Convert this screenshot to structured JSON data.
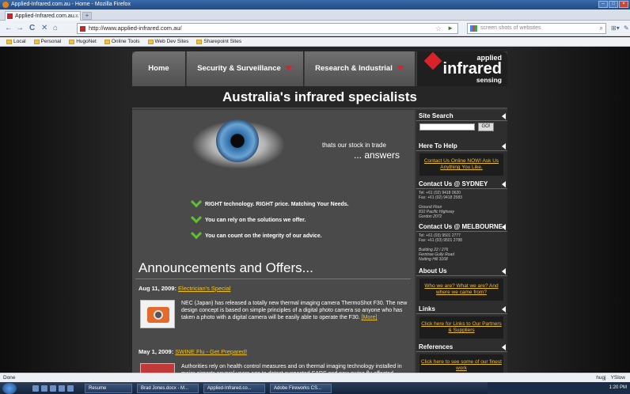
{
  "window": {
    "title": "Applied-Infrared.com.au - Home - Mozilla Firefox"
  },
  "tab": {
    "label": "Applied-Infrared.com.au...",
    "close": "×",
    "new_tab": "+"
  },
  "nav": {
    "back": "←",
    "forward": "→",
    "reload": "C",
    "stop": "✕",
    "home": "⌂",
    "url": "http://www.applied-infrared.com.au/",
    "bookmark_star": "☆",
    "go": "►",
    "search_placeholder": "screen shots of websites",
    "search_icon": "⌕",
    "menu": "⊞▾",
    "tools": "✎"
  },
  "bookmarks": [
    "Local",
    "Personal",
    "HugoNet",
    "Online Tools",
    "Web Dev Sites",
    "Sharepoint Sites"
  ],
  "site": {
    "nav": {
      "home": "Home",
      "security": "Security & Surveillance",
      "research": "Research & Industrial"
    },
    "logo": {
      "top": "applied",
      "main": "infrared",
      "bottom": "sensing"
    },
    "tagline": "Australia's infrared specialists",
    "hero": {
      "line1": "thats our stock in trade",
      "line2": "... answers"
    },
    "features": [
      "RIGHT technology. RIGHT price. Matching Your Needs.",
      "You can rely on the solutions we offer.",
      "You can count on the integrity of our advice."
    ],
    "announcements": {
      "heading": "Announcements and Offers...",
      "items": [
        {
          "date": "Aug 11, 2009:",
          "title": "Electrician's Special",
          "body": "NEC (Japan) has released a totally new thermal imaging camera ThermoShot F30. The new design concept is based on simple principles of a digital photo camera so anyone who has taken a photo with a digital camera will be easily able to operate the F30.",
          "more": "[More]"
        },
        {
          "date": "May 1, 2009:",
          "title": "SWINE Flu - Get Prepared!",
          "body": "Authorities rely on health control measures and on thermal imaging technology installed in major airports several years ago to detect suspected SARS and now swine flu affected passengers... But just how effective are those thermal cameras?",
          "more": ""
        }
      ]
    },
    "sidebar": {
      "site_search": {
        "heading": "Site Search",
        "go": "GO!"
      },
      "help": {
        "heading": "Here To Help",
        "link": "Contact Us Online NOW! Ask Us Anything You Like."
      },
      "sydney": {
        "heading": "Contact Us @ SYDNEY",
        "tel": "Tel: +61 (02) 9418 0620",
        "fax": "Fax: +61 (02) 9418 2583",
        "addr1": "Ground Floor",
        "addr2": "810 Pacific Highway",
        "addr3": "Gordon 2072"
      },
      "melbourne": {
        "heading": "Contact Us @ MELBOURNE",
        "tel": "Tel: +61 (03) 9501 2777",
        "fax": "Fax: +61 (03) 9501 2788",
        "addr1": "Building 22 / 276",
        "addr2": "Ferntree Gully Road",
        "addr3": "Notting Hill 3168"
      },
      "about": {
        "heading": "About Us",
        "link": "Who we are? What we are? And where we came from?"
      },
      "links": {
        "heading": "Links",
        "link": "Click here for Links to Our Partners & Suppliers"
      },
      "references": {
        "heading": "References",
        "link": "Click here to see some of our finest work"
      }
    }
  },
  "status": {
    "left": "Done",
    "right1": "hugj",
    "right2": "YSlow"
  },
  "taskbar": {
    "tasks": [
      "Resume",
      "Brad Jones.docx - M...",
      "Applied-Infrared.co...",
      "Adobe Fireworks CS..."
    ],
    "clock": "1:20 PM"
  }
}
